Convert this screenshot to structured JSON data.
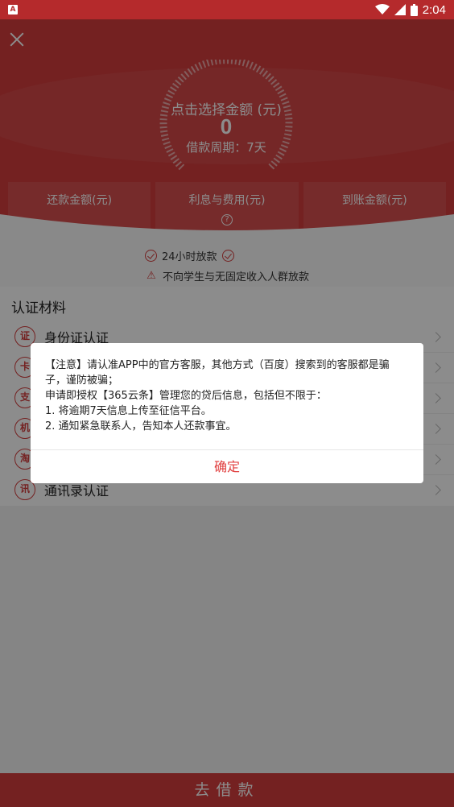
{
  "status_bar": {
    "time": "2:04",
    "left_icon": "A"
  },
  "header": {
    "dial_title": "点击选择金额 (元)",
    "amount": "0",
    "period": "借款周期：7天"
  },
  "stats": [
    {
      "label": "还款金额(元)"
    },
    {
      "label": "利息与费用(元)",
      "help": "?"
    },
    {
      "label": "到账金额(元)"
    }
  ],
  "features": {
    "fast_loan": "24小时放款",
    "notice": "不向学生与无固定收入人群放款"
  },
  "cert": {
    "title": "认证材料",
    "items": [
      {
        "label": "身份证认证",
        "icon": "id-card-icon",
        "glyph": "证"
      },
      {
        "label": "",
        "icon": "card-icon",
        "glyph": "卡"
      },
      {
        "label": "",
        "icon": "alipay-icon",
        "glyph": "支"
      },
      {
        "label": "",
        "icon": "phone-icon",
        "glyph": "机"
      },
      {
        "label": "",
        "icon": "taobao-icon",
        "glyph": "淘"
      },
      {
        "label": "通讯录认证",
        "icon": "contacts-icon",
        "glyph": "讯"
      }
    ]
  },
  "submit_label": "去借款",
  "dialog": {
    "line1": "【注意】请认准APP中的官方客服，其他方式（百度）搜索到的客服都是骗子，谨防被骗；",
    "line2": "申请即授权【365云条】管理您的贷后信息，包括但不限于：",
    "line3": "1. 将逾期7天信息上传至征信平台。",
    "line4": "2. 通知紧急联系人，告知本人还款事宜。",
    "confirm": "确定"
  },
  "colors": {
    "brand_red": "#d43c3c",
    "confirm_red": "#e03c3c"
  }
}
